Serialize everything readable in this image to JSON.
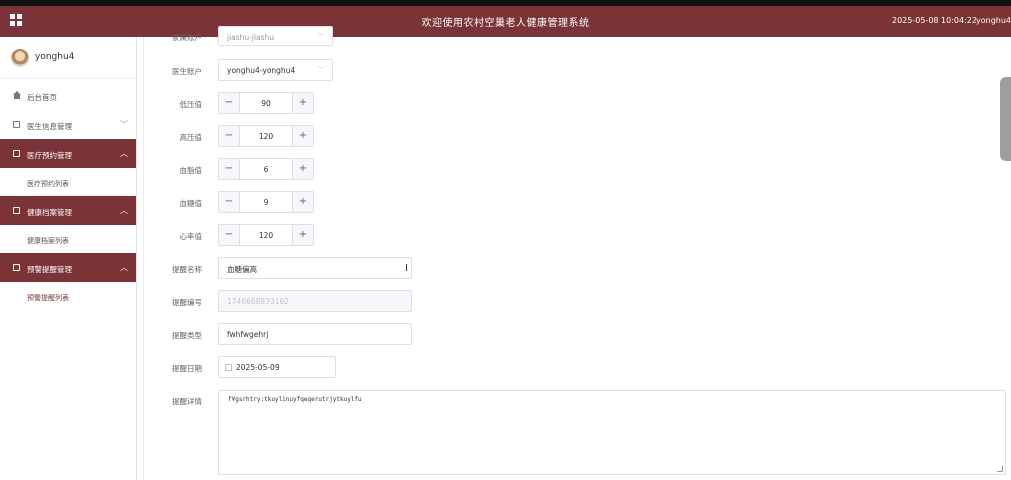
{
  "header": {
    "title": "欢迎使用农村空巢老人健康管理系统",
    "datetime": "2025-05-08 10:04:22",
    "username": "yonghu4",
    "background": "#7a3337"
  },
  "sidebar": {
    "profile_name": "yonghu4",
    "items": [
      {
        "label": "后台首页"
      },
      {
        "label": "医生信息管理",
        "chevron": "﹀"
      },
      {
        "label": "医疗预约管理",
        "chevron": "︿",
        "sub": "医疗预约列表"
      },
      {
        "label": "健康档案管理",
        "chevron": "︿",
        "sub": "健康档案列表"
      },
      {
        "label": "预警提醒管理",
        "chevron": "︿",
        "sub": "预警提醒列表"
      }
    ]
  },
  "form": {
    "top_field": {
      "label": "家属账户",
      "value": "jiashu-jiashu"
    },
    "user_account": {
      "label": "医生账户",
      "value": "yonghu4-yonghu4"
    },
    "low_pressure": {
      "label": "低压值",
      "value": "90"
    },
    "high_pressure": {
      "label": "高压值",
      "value": "120"
    },
    "blood_lipid": {
      "label": "血脂值",
      "value": "6"
    },
    "blood_sugar": {
      "label": "血糖值",
      "value": "9"
    },
    "heart_rate": {
      "label": "心率值",
      "value": "120"
    },
    "alert_name": {
      "label": "提醒名称",
      "value": "血糖偏高"
    },
    "alert_no": {
      "label": "提醒编号",
      "value": "1746668833162"
    },
    "alert_type": {
      "label": "提醒类型",
      "value": "fwhfwgehrj"
    },
    "alert_date": {
      "label": "提醒日期",
      "value": "2025-05-09"
    },
    "alert_detail": {
      "label": "提醒详情",
      "value": "f¥gsrhtry:tkuylinuyfqeqerutrjytkuylfu"
    }
  },
  "symbols": {
    "minus": "−",
    "plus": "+",
    "select_arrow": "﹀",
    "text_cursor": "I"
  }
}
